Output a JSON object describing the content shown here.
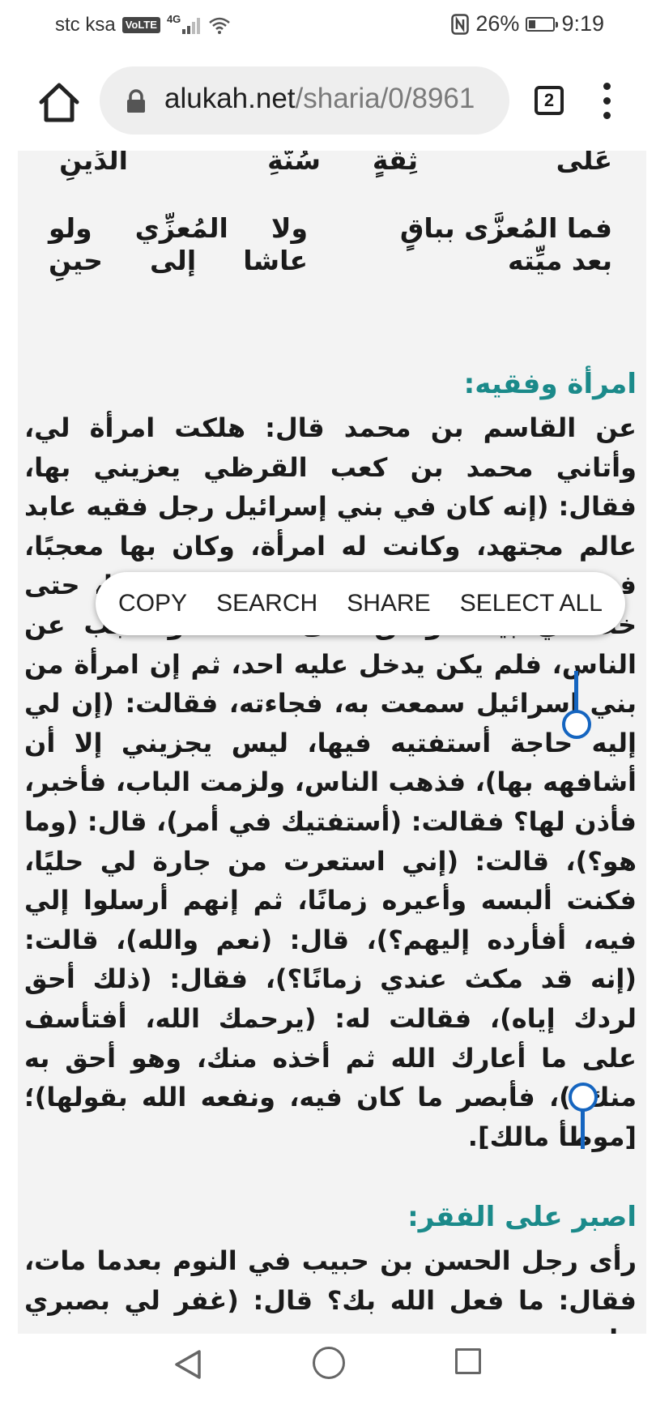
{
  "status_bar": {
    "carrier": "stc ksa",
    "volte": "VoLTE",
    "network": "4G",
    "battery_percent": "26%",
    "battery_level": 0.26,
    "time": "9:19"
  },
  "browser": {
    "url_host": "alukah.net",
    "url_path": "/sharia/0/8961",
    "tab_count": "2"
  },
  "poem": {
    "row1": [
      "عَلَى",
      "ثِقَةٍ",
      "سُنَّةِ",
      "الدِّينِ"
    ],
    "row2": [
      "فما المُعزَّى بباقٍ بعد ميِّته",
      "ولا المُعزِّي ولو عاشا إلى حينِ"
    ]
  },
  "section1": {
    "heading": "امرأة وفقيه:",
    "body": "عن القاسم بن محمد قال: هلكت امرأة لي، وأتاني محمد بن كعب القرظي يعزيني بها، فقال: (إنه كان في بني إسرائيل رجل فقيه عابد عالم مجتهد، وكانت له امرأة، وكان بها معجبًا، فماتت، فوجد - حزن - عليها وجدًا شديدًا، حتى خلا في بيت، وغلق على نفسه، واحتجب عن الناس، فلم يكن يدخل عليه احد، ثم إن امرأة من بني إسرائيل سمعت به، فجاءته، فقالت: (إن لي إليه حاجة أستفتيه فيها، ليس يجزيني إلا أن أشافهه بها)، فذهب الناس، ولزمت الباب، فأخبر، فأذن لها؟ فقالت: (أستفتيك في أمر)، قال: (وما هو؟)، قالت: (إني استعرت من جارة لي حليًا، فكنت ألبسه وأعيره زمانًا، ثم إنهم أرسلوا إلي فيه، أفأرده إليهم؟)، قال: (نعم والله)، قالت: (إنه قد مكث عندي زمانًا؟)، فقال: (ذلك أحق لردك إياه)، فقالت له: (يرحمك الله، أفتأسف على ما أعارك الله ثم أخذه منك، وهو أحق به منك؟)، فأبصر ما كان فيه، ونفعه الله بقولها)؛ [موطأ مالك]."
  },
  "section2": {
    "heading": "اصبر على الفقر:",
    "body": "رأى رجل الحسن بن حبيب في النوم بعدما مات، فقال: ما فعل الله بك؟ قال: (غفر لي بصبري على"
  },
  "selection_menu": {
    "copy": "COPY",
    "search": "SEARCH",
    "share": "SHARE",
    "select_all": "SELECT ALL"
  }
}
